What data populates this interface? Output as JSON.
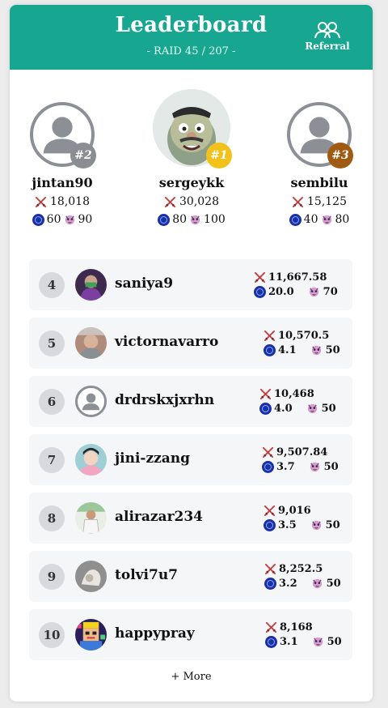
{
  "header": {
    "title": "Leaderboard",
    "subtitle": "- RAID 45 / 207 -",
    "referral_label": "Referral",
    "bg_color": "#17a68f"
  },
  "podium": [
    {
      "rank_label": "#2",
      "name": "jintan90",
      "score": "18,018",
      "coins": "60",
      "pets": "90",
      "badge_color": "#8a8d92"
    },
    {
      "rank_label": "#1",
      "name": "sergeykk",
      "score": "30,028",
      "coins": "80",
      "pets": "100",
      "badge_color": "#f2c21a"
    },
    {
      "rank_label": "#3",
      "name": "sembilu",
      "score": "15,125",
      "coins": "40",
      "pets": "80",
      "badge_color": "#a15a12"
    }
  ],
  "rows": [
    {
      "rank": "4",
      "name": "saniya9",
      "score": "11,667.58",
      "coins": "20.0",
      "pets": "70"
    },
    {
      "rank": "5",
      "name": "victornavarro",
      "score": "10,570.5",
      "coins": "4.1",
      "pets": "50"
    },
    {
      "rank": "6",
      "name": "drdrskxjxrhn",
      "score": "10,468",
      "coins": "4.0",
      "pets": "50"
    },
    {
      "rank": "7",
      "name": "jini-zzang",
      "score": "9,507.84",
      "coins": "3.7",
      "pets": "50"
    },
    {
      "rank": "8",
      "name": "alirazar234",
      "score": "9,016",
      "coins": "3.5",
      "pets": "50"
    },
    {
      "rank": "9",
      "name": "tolvi7u7",
      "score": "8,252.5",
      "coins": "3.2",
      "pets": "50"
    },
    {
      "rank": "10",
      "name": "happypray",
      "score": "8,168",
      "coins": "3.1",
      "pets": "50"
    }
  ],
  "more_label": "+ More",
  "icons": {
    "score": "crossed-swords-icon",
    "coin": "coin-icon",
    "pet": "pet-icon",
    "referral": "people-icon"
  }
}
